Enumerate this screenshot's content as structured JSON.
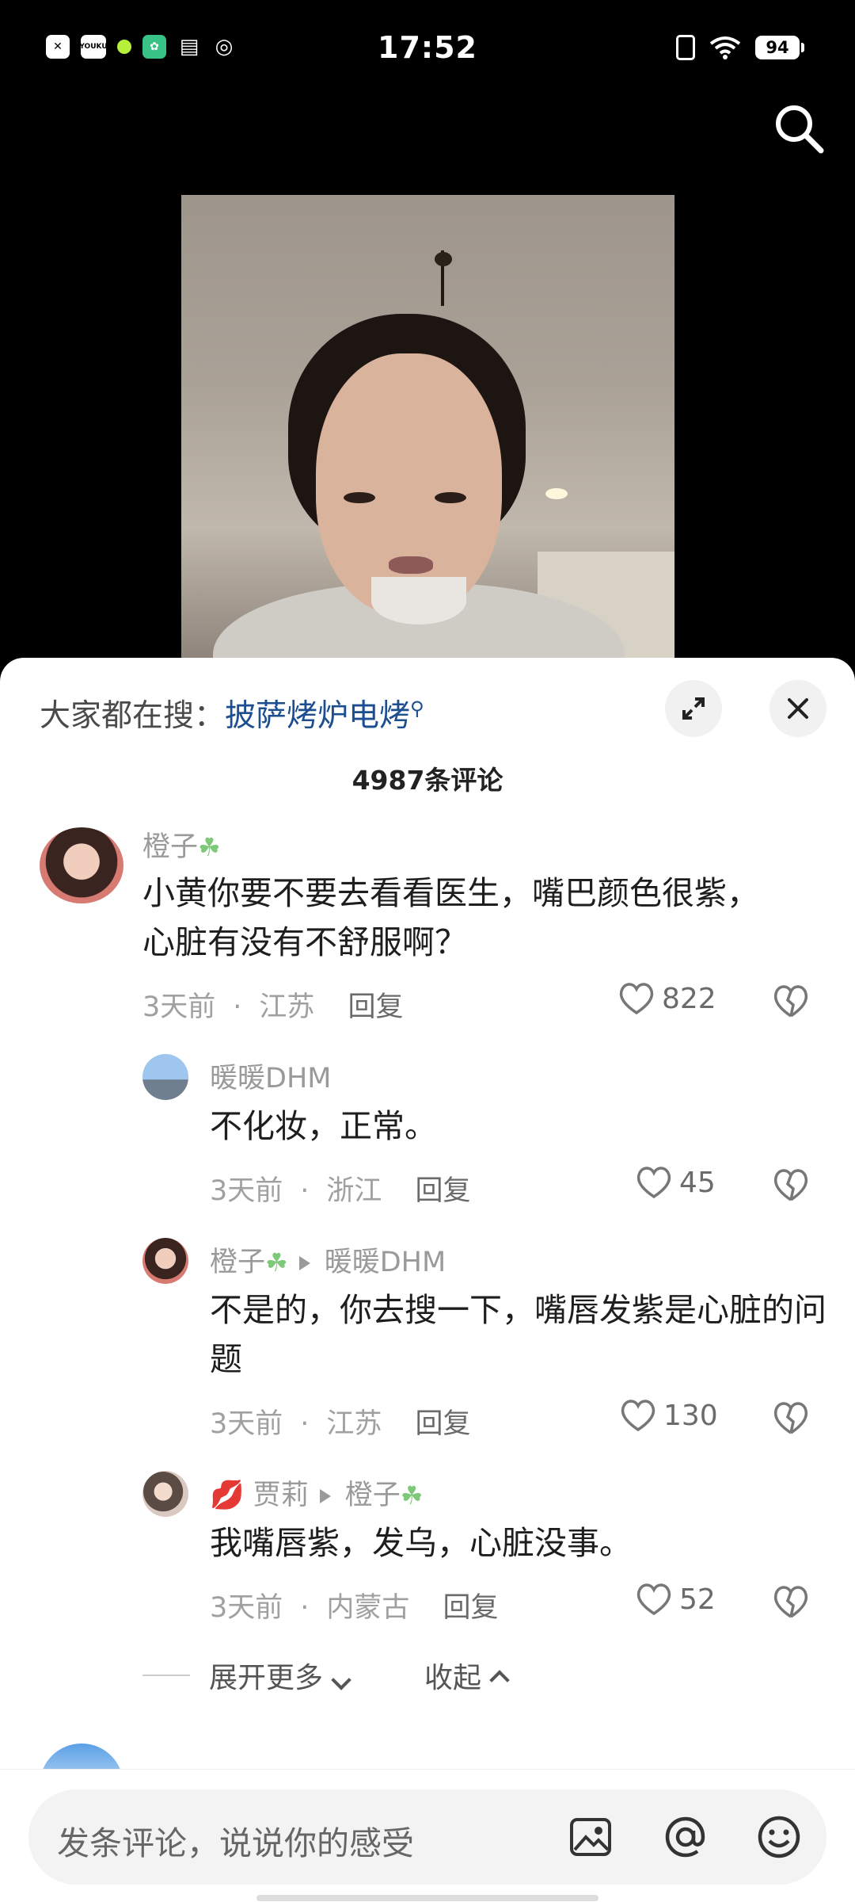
{
  "status_bar": {
    "time": "17:52",
    "battery": "94",
    "app_icons": [
      "x-app-icon",
      "youku-icon",
      "green-dot-icon",
      "chatgpt-icon",
      "reader-icon",
      "swirl-icon"
    ],
    "youku_label": "YOUKU"
  },
  "search_bar": {
    "prefix": "大家都在搜：",
    "keyword": "披萨烤炉电烤"
  },
  "comments_header": {
    "count": "4987条评论"
  },
  "comments": [
    {
      "user": "橙子",
      "text": "小黄你要不要去看看医生，嘴巴颜色很紫，心脏有没有不舒服啊？",
      "time": "3天前",
      "location": "江苏",
      "reply_label": "回复",
      "likes": "822"
    },
    {
      "user": "暖暖DHM",
      "text": "不化妆，正常。",
      "time": "3天前",
      "location": "浙江",
      "reply_label": "回复",
      "likes": "45"
    },
    {
      "user": "橙子",
      "reply_to": "暖暖DHM",
      "text": "不是的，你去搜一下，嘴唇发紫是心脏的问题",
      "time": "3天前",
      "location": "江苏",
      "reply_label": "回复",
      "likes": "130"
    },
    {
      "user": "贾莉",
      "reply_to": "橙子",
      "text": "我嘴唇紫，发乌，心脏没事。",
      "time": "3天前",
      "location": "内蒙古",
      "reply_label": "回复",
      "likes": "52"
    }
  ],
  "thread_controls": {
    "expand_more": "展开更多",
    "collapse": "收起"
  },
  "input_bar": {
    "placeholder": "发条评论，说说你的感受"
  },
  "colors": {
    "keyword_blue": "#1d4e8f",
    "meta_gray": "#a0a0a0",
    "background_top": "#000000"
  }
}
